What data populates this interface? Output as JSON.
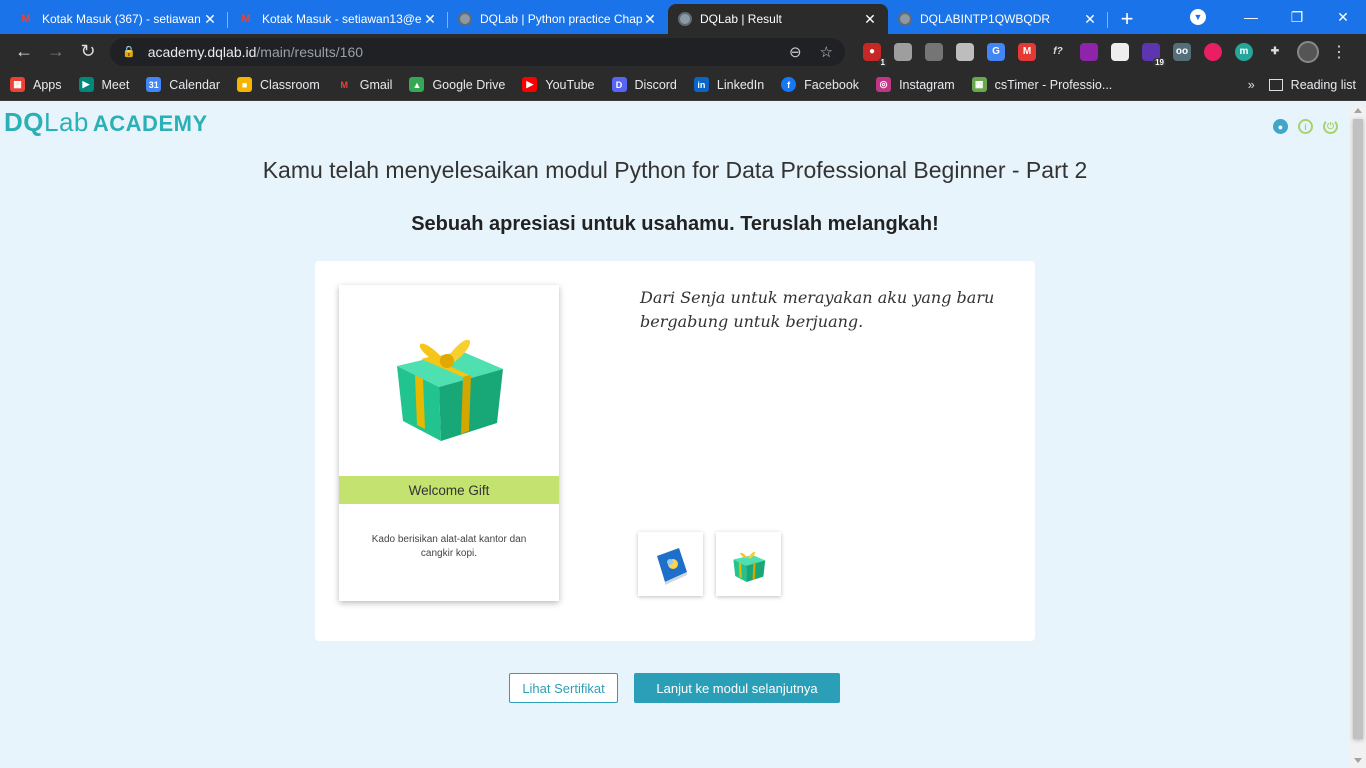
{
  "browser": {
    "tabs": [
      {
        "title": "Kotak Masuk (367) - setiawan",
        "icon": "gmail-icon",
        "active": false
      },
      {
        "title": "Kotak Masuk - setiawan13@e",
        "icon": "gmail-icon",
        "active": false
      },
      {
        "title": "DQLab | Python practice Chap",
        "icon": "globe-icon",
        "active": false
      },
      {
        "title": "DQLab | Result",
        "icon": "globe-icon",
        "active": true
      },
      {
        "title": "DQLABINTP1QWBQDR",
        "icon": "globe-icon",
        "active": false
      }
    ],
    "new_tab": "+",
    "url_host": "academy.dqlab.id",
    "url_path": "/main/results/160",
    "ext_badges": {
      "ext1": "1",
      "ext2": "19"
    },
    "bookmarks": [
      {
        "label": "Apps",
        "icon": "apps-grid-icon",
        "color": "#ea4335"
      },
      {
        "label": "Meet",
        "icon": "meet-icon",
        "color": "#00897b"
      },
      {
        "label": "Calendar",
        "icon": "calendar-icon",
        "color": "#4285f4"
      },
      {
        "label": "Classroom",
        "icon": "classroom-icon",
        "color": "#f4b400"
      },
      {
        "label": "Gmail",
        "icon": "gmail-icon",
        "color": "#ea4335"
      },
      {
        "label": "Google Drive",
        "icon": "drive-icon",
        "color": "#34a853"
      },
      {
        "label": "YouTube",
        "icon": "youtube-icon",
        "color": "#ff0000"
      },
      {
        "label": "Discord",
        "icon": "discord-icon",
        "color": "#5865f2"
      },
      {
        "label": "LinkedIn",
        "icon": "linkedin-icon",
        "color": "#0a66c2"
      },
      {
        "label": "Facebook",
        "icon": "facebook-icon",
        "color": "#1877f2"
      },
      {
        "label": "Instagram",
        "icon": "instagram-icon",
        "color": "#c13584"
      },
      {
        "label": "csTimer - Professio...",
        "icon": "cstimer-icon",
        "color": "#6aa84f"
      }
    ],
    "more": "»",
    "reading_list": "Reading list"
  },
  "page": {
    "logo_dq": "DQ",
    "logo_lab": "Lab",
    "logo_academy": "ACADEMY",
    "heading": "Kamu telah menyelesaikan modul Python for Data Professional Beginner - Part 2",
    "subheading": "Sebuah apresiasi untuk usahamu. Teruslah melangkah!",
    "card": {
      "label": "Welcome Gift",
      "description": "Kado berisikan alat-alat kantor dan cangkir kopi."
    },
    "note": "Dari Senja untuk merayakan aku yang baru bergabung untuk berjuang.",
    "thumbs": [
      "book-icon",
      "gift-icon"
    ],
    "buttons": {
      "certificate": "Lihat Sertifikat",
      "next": "Lanjut ke modul selanjutnya"
    },
    "colors": {
      "accent": "#2b9fb7",
      "gift_label": "#c3e26f",
      "page_bg": "#e8f4fb"
    }
  }
}
